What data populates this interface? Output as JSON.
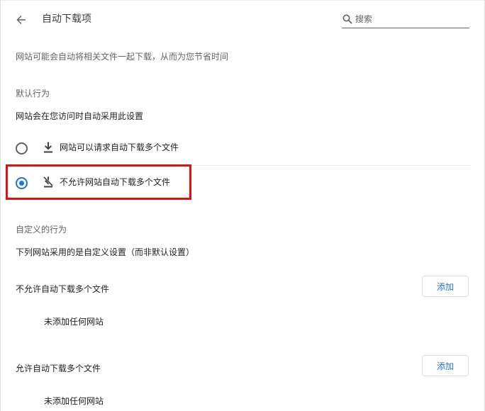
{
  "header": {
    "title": "自动下载项",
    "search_placeholder": "搜索"
  },
  "description": "网站可能会自动将相关文件一起下载，从而为您节省时间",
  "default_behavior": {
    "heading": "默认行为",
    "subheading": "网站会在您访问时自动采用此设置",
    "options": [
      {
        "label": "网站可以请求自动下载多个文件",
        "icon": "download-icon",
        "selected": false
      },
      {
        "label": "不允许网站自动下载多个文件",
        "icon": "download-off-icon",
        "selected": true
      }
    ]
  },
  "custom_behavior": {
    "heading": "自定义的行为",
    "subheading": "下列网站采用的是自定义设置（而非默认设置）",
    "lists": [
      {
        "title": "不允许自动下载多个文件",
        "add_label": "添加",
        "empty_text": "未添加任何网站"
      },
      {
        "title": "允许自动下载多个文件",
        "add_label": "添加",
        "empty_text": "未添加任何网站"
      }
    ]
  },
  "colors": {
    "accent": "#1a73e8",
    "highlight": "#e01010"
  }
}
